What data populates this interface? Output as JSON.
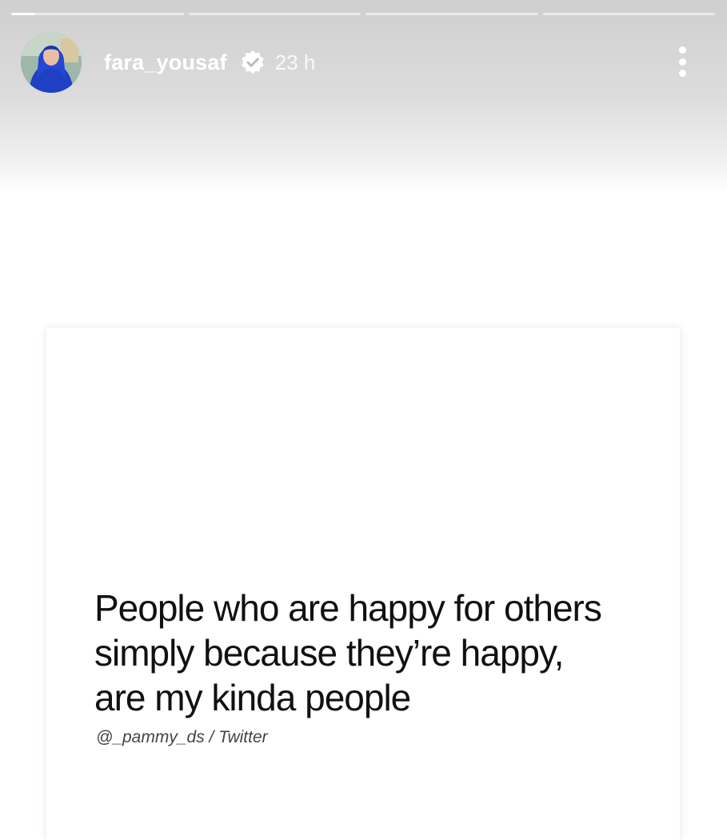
{
  "story": {
    "progress_segments": [
      0.14,
      0,
      0,
      0
    ],
    "username": "fara_yousaf",
    "verified": true,
    "time_ago": "23 h",
    "more_icon": "more-vertical-icon",
    "verified_icon": "verified-badge-icon"
  },
  "post": {
    "quote_lines": [
      "People who are happy for others",
      "simply because they’re happy,",
      "are my kinda people"
    ],
    "source": "@_pammy_ds / Twitter"
  },
  "colors": {
    "header_gradient_top": "#cfcfcf",
    "text_primary": "#111111",
    "text_secondary": "#444444",
    "avatar_scarf": "#1f3fc4"
  }
}
